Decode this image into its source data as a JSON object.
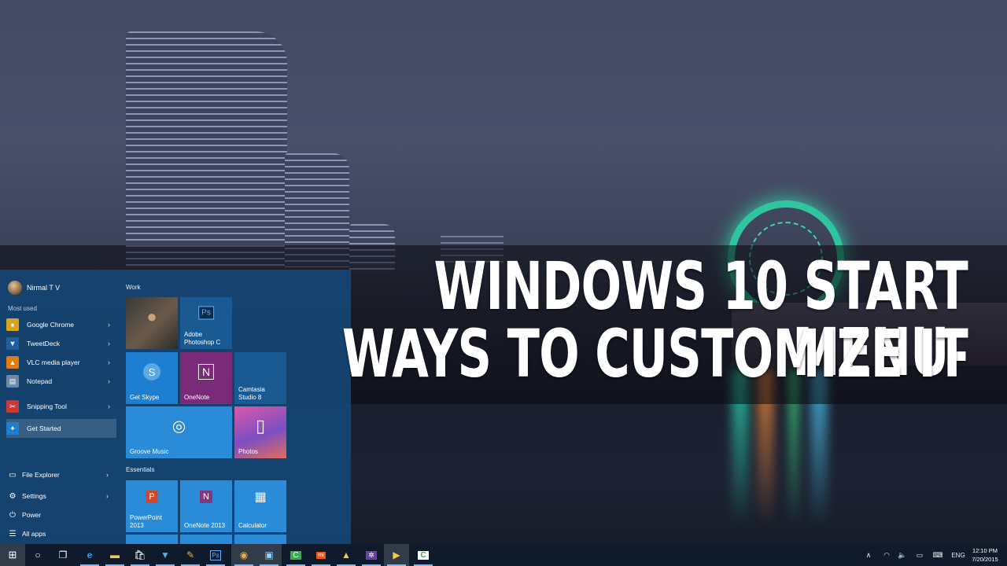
{
  "title": {
    "line1": "WINDOWS 10 START MENU-",
    "line2": "WAYS TO CUSTOMIZE IT"
  },
  "start_menu": {
    "user_name": "Nirmal T V",
    "most_used_label": "Most used",
    "most_used": [
      {
        "label": "Google Chrome",
        "icon": "chrome-icon",
        "color": "#d9a521"
      },
      {
        "label": "TweetDeck",
        "icon": "tweetdeck-icon",
        "color": "#1f5fa0"
      },
      {
        "label": "VLC media player",
        "icon": "vlc-icon",
        "color": "#e07b12"
      },
      {
        "label": "Notepad",
        "icon": "notepad-icon",
        "color": "#6d89a8"
      }
    ],
    "recent": [
      {
        "label": "Snipping Tool",
        "icon": "snipping-tool-icon",
        "color": "#c83a3a"
      },
      {
        "label": "Get Started",
        "icon": "lightbulb-icon",
        "color": "#1e7fd1"
      }
    ],
    "system": [
      {
        "label": "File Explorer",
        "icon": "folder-icon"
      },
      {
        "label": "Settings",
        "icon": "gear-icon"
      },
      {
        "label": "Power",
        "icon": "power-icon"
      },
      {
        "label": "All apps",
        "icon": "all-apps-icon"
      }
    ],
    "groups": {
      "work": "Work",
      "essentials": "Essentials"
    },
    "tiles": {
      "adobe_ps": "Adobe\nPhotoshop C",
      "get_skype": "Get Skype",
      "onenote": "OneNote",
      "camtasia": "Camtasia\nStudio 8",
      "groove": "Groove Music",
      "photos": "Photos",
      "powerpoint": "PowerPoint\n2013",
      "onenote2013": "OneNote 2013",
      "calculator": "Calculator"
    }
  },
  "taskbar": {
    "language": "ENG",
    "time": "12:10 PM",
    "date": "7/20/2015"
  },
  "colors": {
    "accent": "#1e7fd1",
    "start_bg": "#144878",
    "taskbar_bg": "#0f1a2a"
  }
}
